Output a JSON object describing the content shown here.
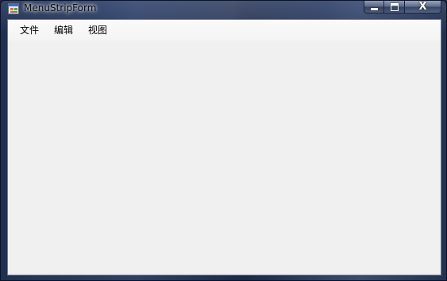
{
  "window": {
    "title": "MenuStripForm",
    "caption_buttons": {
      "minimize_icon": "minimize-icon",
      "maximize_icon": "maximize-icon",
      "close_label": "X"
    }
  },
  "menu": {
    "items": [
      {
        "label": "文件"
      },
      {
        "label": "编辑"
      },
      {
        "label": "视图"
      }
    ]
  },
  "colors": {
    "client_background": "#f0f0f0",
    "menustrip_background": "#f8f8f8"
  }
}
